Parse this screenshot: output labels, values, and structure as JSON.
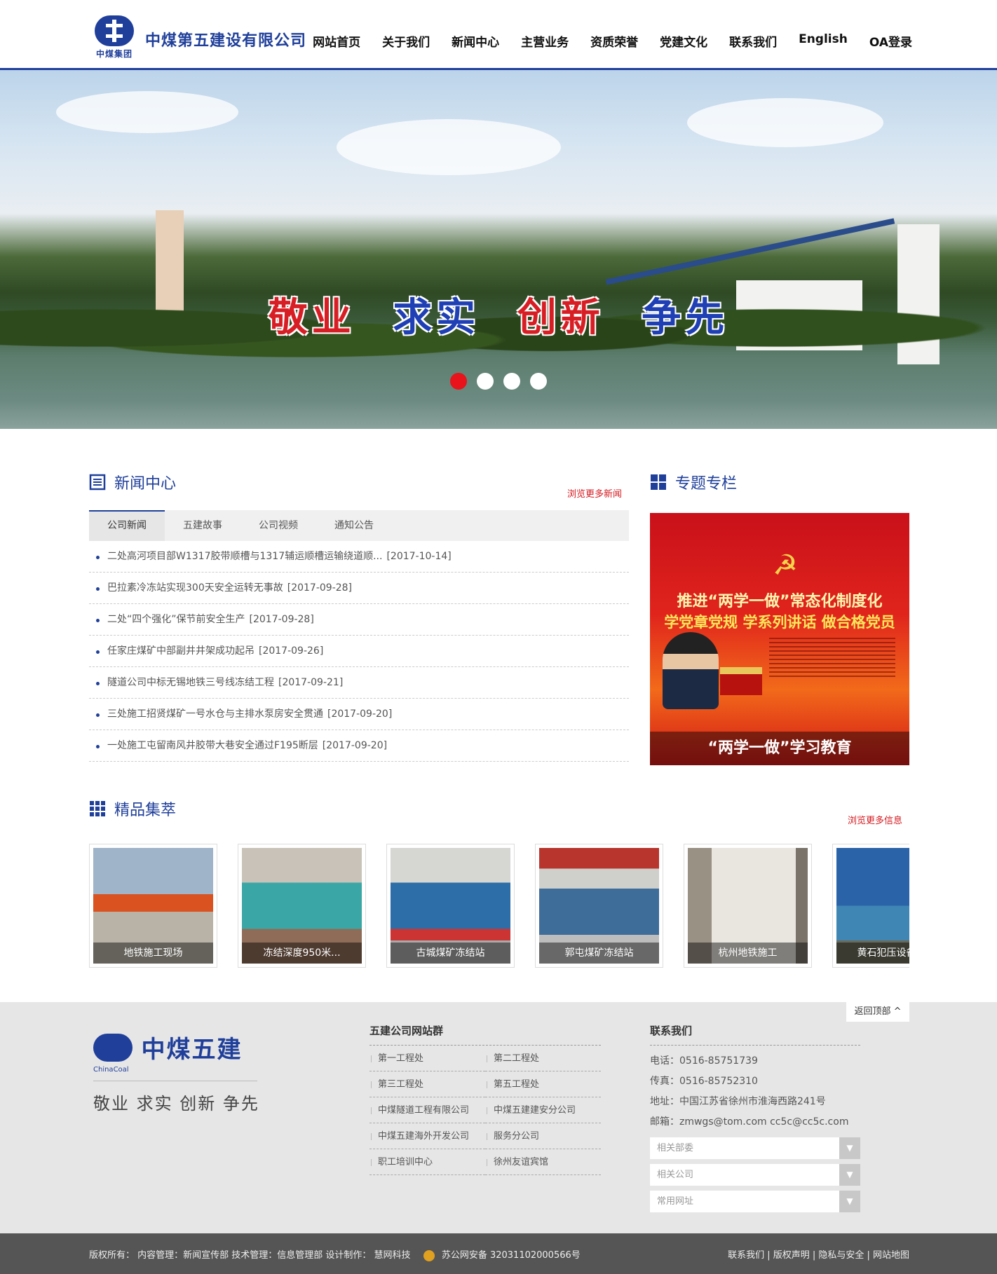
{
  "header": {
    "logo_sub": "中煤集团",
    "company_name": "中煤第五建设有限公司",
    "nav": [
      "网站首页",
      "关于我们",
      "新闻中心",
      "主营业务",
      "资质荣誉",
      "党建文化",
      "联系我们",
      "English",
      "OA登录"
    ]
  },
  "banner": {
    "slogan": [
      "敬业",
      "求实",
      "创新",
      "争先"
    ],
    "slide_count": 4,
    "active_slide": 1
  },
  "news": {
    "title": "新闻中心",
    "more": "浏览更多新闻",
    "tabs": [
      "公司新闻",
      "五建故事",
      "公司视频",
      "通知公告"
    ],
    "items": [
      {
        "text": "二处高河项目部W1317胶带顺槽与1317辅运顺槽运输绕道顺...",
        "date": "[2017-10-14]"
      },
      {
        "text": "巴拉素冷冻站实现300天安全运转无事故",
        "date": "[2017-09-28]"
      },
      {
        "text": "二处“四个强化”保节前安全生产",
        "date": "[2017-09-28]"
      },
      {
        "text": "任家庄煤矿中部副井井架成功起吊",
        "date": "[2017-09-26]"
      },
      {
        "text": "隧道公司中标无锡地铁三号线冻结工程",
        "date": "[2017-09-21]"
      },
      {
        "text": "三处施工招贤煤矿一号水仓与主排水泵房安全贯通",
        "date": "[2017-09-20]"
      },
      {
        "text": "一处施工屯留南风井胶带大巷安全通过F195断层",
        "date": "[2017-09-20]"
      }
    ]
  },
  "topic": {
    "title": "专题专栏",
    "poster_line1": "推进“两学一做”常态化制度化",
    "poster_line2": "学党章党规 学系列讲话 做合格党员",
    "caption": "“两学一做”学习教育"
  },
  "gallery": {
    "title": "精品集萃",
    "more": "浏览更多信息",
    "items": [
      {
        "caption": "地铁施工现场"
      },
      {
        "caption": "冻结深度950米..."
      },
      {
        "caption": "古城煤矿冻结站"
      },
      {
        "caption": "郭屯煤矿冻结站"
      },
      {
        "caption": "杭州地铁施工"
      },
      {
        "caption": "黄石犯压设备厂房"
      }
    ]
  },
  "footer": {
    "back_top": "返回顶部 ^",
    "logo_name": "中煤五建",
    "logo_en": "ChinaCoal",
    "slogan": "敬业 求实 创新 争先",
    "links_title": "五建公司网站群",
    "links": [
      "第一工程处",
      "第二工程处",
      "第三工程处",
      "第五工程处",
      "中煤隧道工程有限公司",
      "中煤五建建安分公司",
      "中煤五建海外开发公司",
      "服务分公司",
      "职工培训中心",
      "徐州友谊宾馆"
    ],
    "contact_title": "联系我们",
    "phone": "电话：0516-85751739",
    "fax": "传真：0516-85752310",
    "address": "地址：中国江苏省徐州市淮海西路241号",
    "email": "邮箱：zmwgs@tom.com cc5c@cc5c.com",
    "selects": [
      "相关部委",
      "相关公司",
      "常用网址"
    ]
  },
  "bottom": {
    "copyright": "版权所有： 内容管理：新闻宣传部 技术管理：信息管理部 设计制作：",
    "designer": "慧网科技",
    "icp": "苏公网安备 32031102000566号",
    "links": "联系我们 | 版权声明 | 隐私与安全 | 网站地图"
  },
  "colors": {
    "brand": "#1f3f9a",
    "accent": "#d4191f",
    "slogan_red": "#d81e25",
    "slogan_blue": "#1f3fb5"
  }
}
